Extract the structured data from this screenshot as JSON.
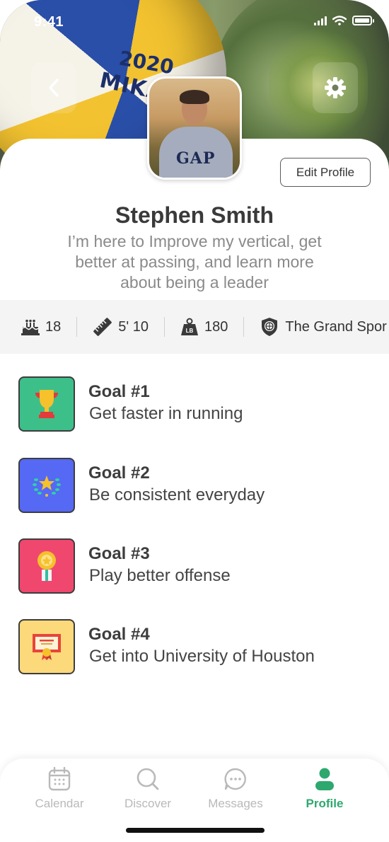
{
  "status_bar": {
    "time": "9:41"
  },
  "header": {
    "cover_text": {
      "year": "2020",
      "brand": "MIKASA"
    }
  },
  "profile": {
    "edit_label": "Edit Profile",
    "name": "Stephen Smith",
    "bio": "I’m here to Improve my vertical, get better at passing, and learn more about being a leader",
    "avatar_shirt_text": "GAP"
  },
  "stats": [
    {
      "icon": "birthday-cake-icon",
      "value": "18"
    },
    {
      "icon": "ruler-icon",
      "value": "5' 10"
    },
    {
      "icon": "weight-lb-icon",
      "value": "180"
    },
    {
      "icon": "school-crest-icon",
      "value": "The Grand Spor"
    }
  ],
  "goals": [
    {
      "title": "Goal #1",
      "desc": "Get faster in running",
      "icon": "trophy-icon",
      "color": "#3dbf8a"
    },
    {
      "title": "Goal #2",
      "desc": "Be consistent everyday",
      "icon": "star-wreath-icon",
      "color": "#5569f5"
    },
    {
      "title": "Goal #3",
      "desc": "Play better offense",
      "icon": "medal-icon",
      "color": "#f0476f"
    },
    {
      "title": "Goal #4",
      "desc": "Get into University of Houston",
      "icon": "certificate-icon",
      "color": "#fcd97a"
    }
  ],
  "tabs": [
    {
      "label": "Calendar",
      "icon": "calendar-icon",
      "active": false
    },
    {
      "label": "Discover",
      "icon": "search-icon",
      "active": false
    },
    {
      "label": "Messages",
      "icon": "chat-bubble-icon",
      "active": false
    },
    {
      "label": "Profile",
      "icon": "person-icon",
      "active": true
    }
  ],
  "colors": {
    "accent": "#2ea86e",
    "inactive_tab": "#b9b9b9",
    "stats_bg": "#f4f4f4"
  }
}
